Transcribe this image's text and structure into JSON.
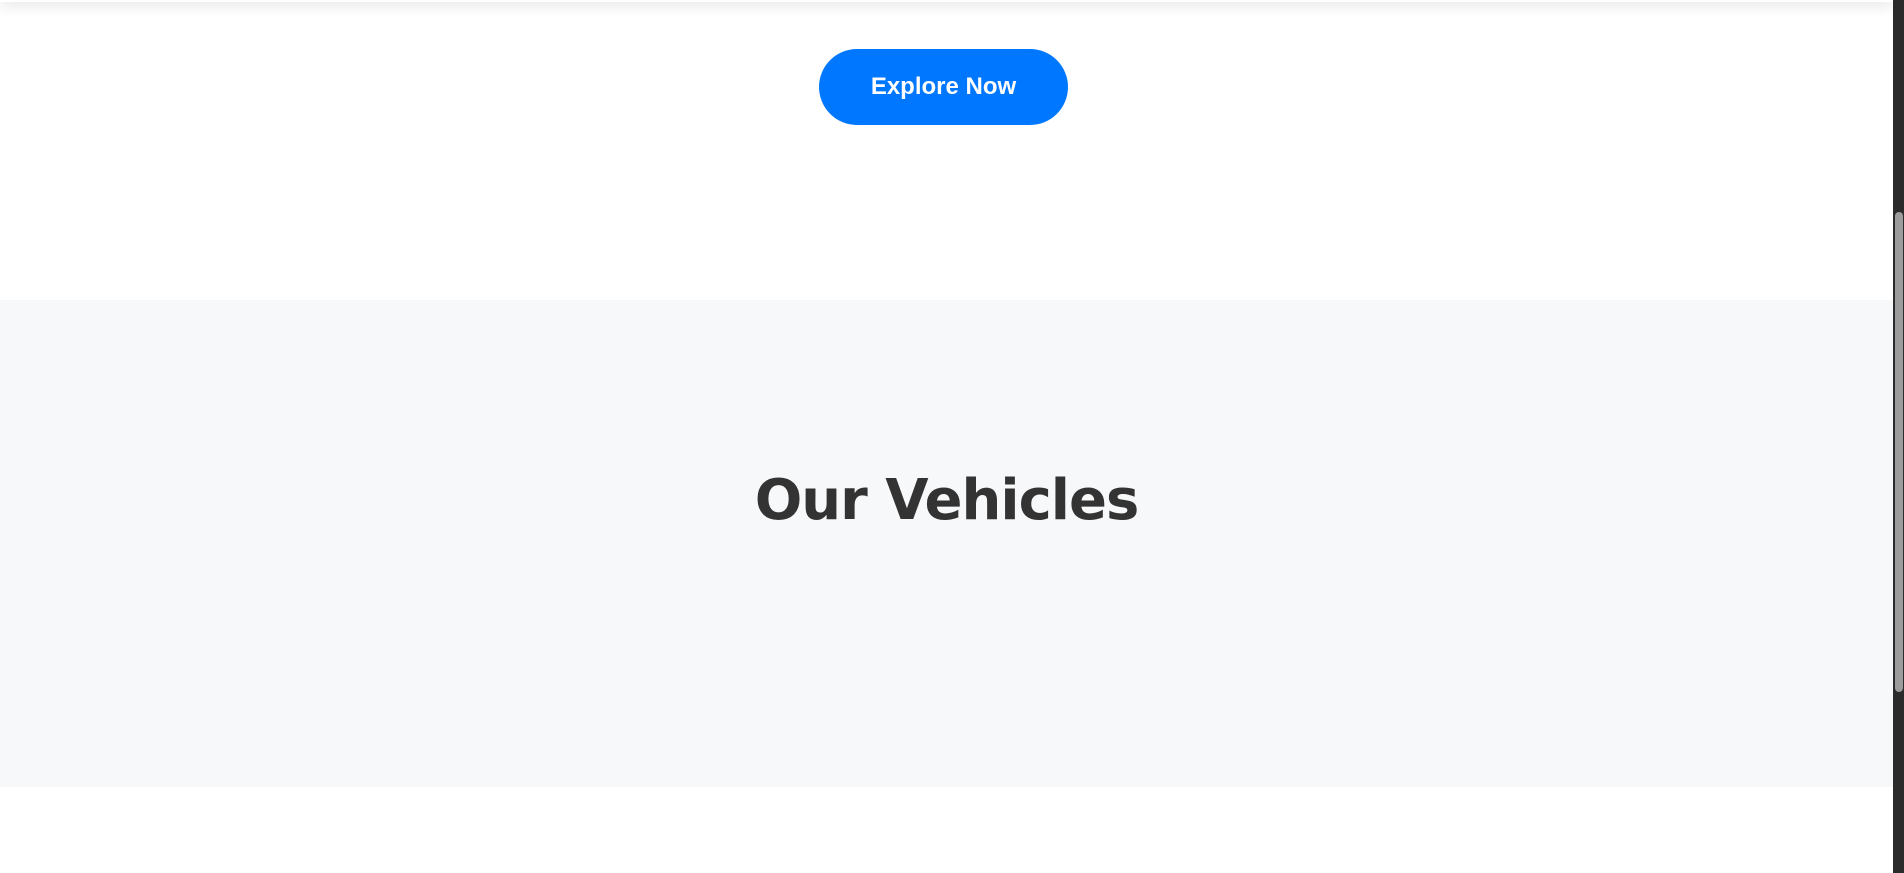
{
  "hero": {
    "cta_label": "Explore Now",
    "cta_color": "#0077ff",
    "cta_text_color": "#ffffff"
  },
  "vehicles_section": {
    "title": "Our Vehicles",
    "background_color": "#f7f8fa",
    "title_color": "#333333"
  },
  "scrollbar": {
    "track_color": "#2b2b2b",
    "thumb_color": "#9c9c9c"
  }
}
